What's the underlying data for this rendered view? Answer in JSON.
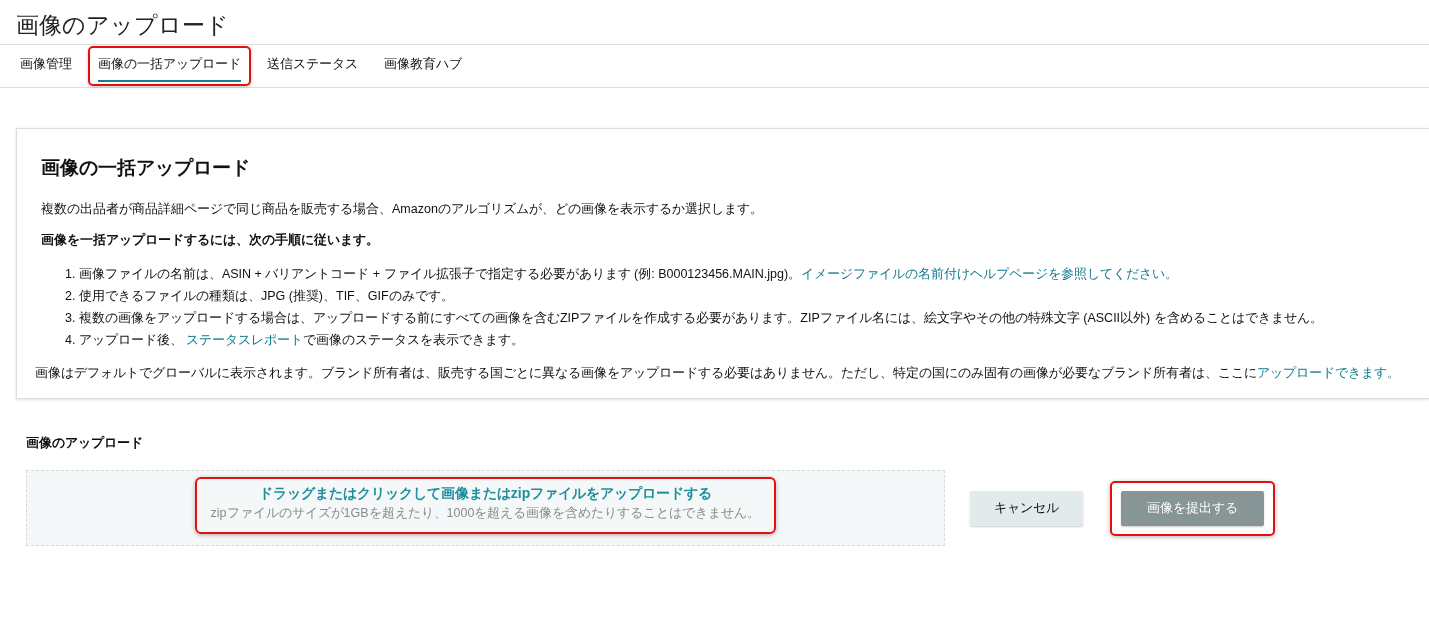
{
  "page": {
    "title": "画像のアップロード"
  },
  "tabs": [
    {
      "label": "画像管理",
      "selected": false,
      "highlighted": false
    },
    {
      "label": "画像の一括アップロード",
      "selected": true,
      "highlighted": true
    },
    {
      "label": "送信ステータス",
      "selected": false,
      "highlighted": false
    },
    {
      "label": "画像教育ハブ",
      "selected": false,
      "highlighted": false
    }
  ],
  "info_card": {
    "heading": "画像の一括アップロード",
    "intro": "複数の出品者が商品詳細ページで同じ商品を販売する場合、Amazonのアルゴリズムが、どの画像を表示するか選択します。",
    "steps_heading": "画像を一括アップロードするには、次の手順に従います。",
    "steps": [
      [
        {
          "kind": "marker",
          "text": "1."
        },
        {
          "kind": "text",
          "text": "画像ファイルの名前は、ASIN + バリアントコード + ファイル拡張子で指定する必要があります (例: B000123456.MAIN.jpg)。"
        },
        {
          "kind": "link",
          "text": "イメージファイルの名前付けヘルプページを参照してください。"
        }
      ],
      [
        {
          "kind": "marker",
          "text": "2."
        },
        {
          "kind": "text",
          "text": "使用できるファイルの種類は、JPG (推奨)、TIF、GIFのみです。"
        }
      ],
      [
        {
          "kind": "marker",
          "text": "3."
        },
        {
          "kind": "text",
          "text": "複数の画像をアップロードする場合は、アップロードする前にすべての画像を含むZIPファイルを作成する必要があります。ZIPファイル名には、絵文字やその他の特殊文字 (ASCII以外) を含めることはできません。"
        }
      ],
      [
        {
          "kind": "marker",
          "text": "4."
        },
        {
          "kind": "text",
          "text": "アップロード後、 "
        },
        {
          "kind": "link",
          "text": "ステータスレポート"
        },
        {
          "kind": "text",
          "text": "で画像のステータスを表示できます。"
        }
      ]
    ],
    "note": [
      {
        "kind": "text",
        "text": "画像はデフォルトでグローバルに表示されます。ブランド所有者は、販売する国ごとに異なる画像をアップロードする必要はありません。ただし、特定の国にのみ固有の画像が必要なブランド所有者は、ここに"
      },
      {
        "kind": "link",
        "text": "アップロードできます。"
      }
    ]
  },
  "upload": {
    "label": "画像のアップロード",
    "dropzone": {
      "title": "ドラッグまたはクリックして画像またはzipファイルをアップロードする",
      "hint": "zipファイルのサイズが1GBを超えたり、1000を超える画像を含めたりすることはできません。",
      "highlighted": true
    },
    "buttons": [
      {
        "label": "キャンセル",
        "kind": "secondary",
        "highlighted": false
      },
      {
        "label": "画像を提出する",
        "kind": "primary",
        "highlighted": true
      }
    ]
  }
}
